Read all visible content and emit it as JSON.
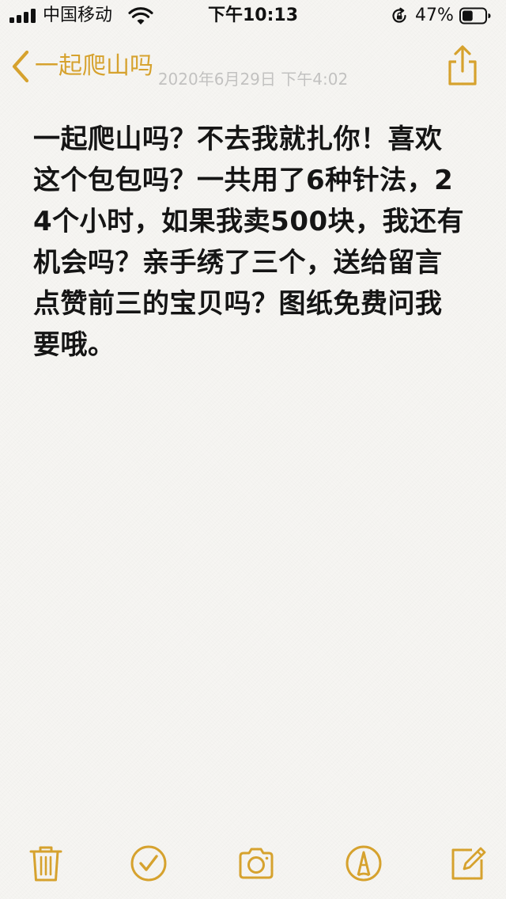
{
  "status_bar": {
    "carrier": "中国移动",
    "time": "下午10:13",
    "battery_percent": "47%",
    "battery_level": 0.47,
    "icons": [
      "signal-icon",
      "wifi-icon",
      "rotation-lock-icon",
      "battery-icon"
    ]
  },
  "nav": {
    "back_label": "一起爬山吗",
    "date": "2020年6月29日 下午4:02",
    "back_icon": "chevron-left-icon",
    "share_icon": "share-icon"
  },
  "note": {
    "text": "一起爬山吗？不去我就扎你！喜欢这个包包吗？一共用了6种针法，24个小时，如果我卖500块，我还有机会吗？亲手绣了三个，送给留言点赞前三的宝贝吗？图纸免费问我要哦。"
  },
  "toolbar": {
    "icons": [
      "trash-icon",
      "checklist-icon",
      "camera-icon",
      "markup-icon",
      "compose-icon"
    ]
  },
  "colors": {
    "accent": "#d6a22e",
    "text": "#151515",
    "background": "#f6f5f2"
  }
}
